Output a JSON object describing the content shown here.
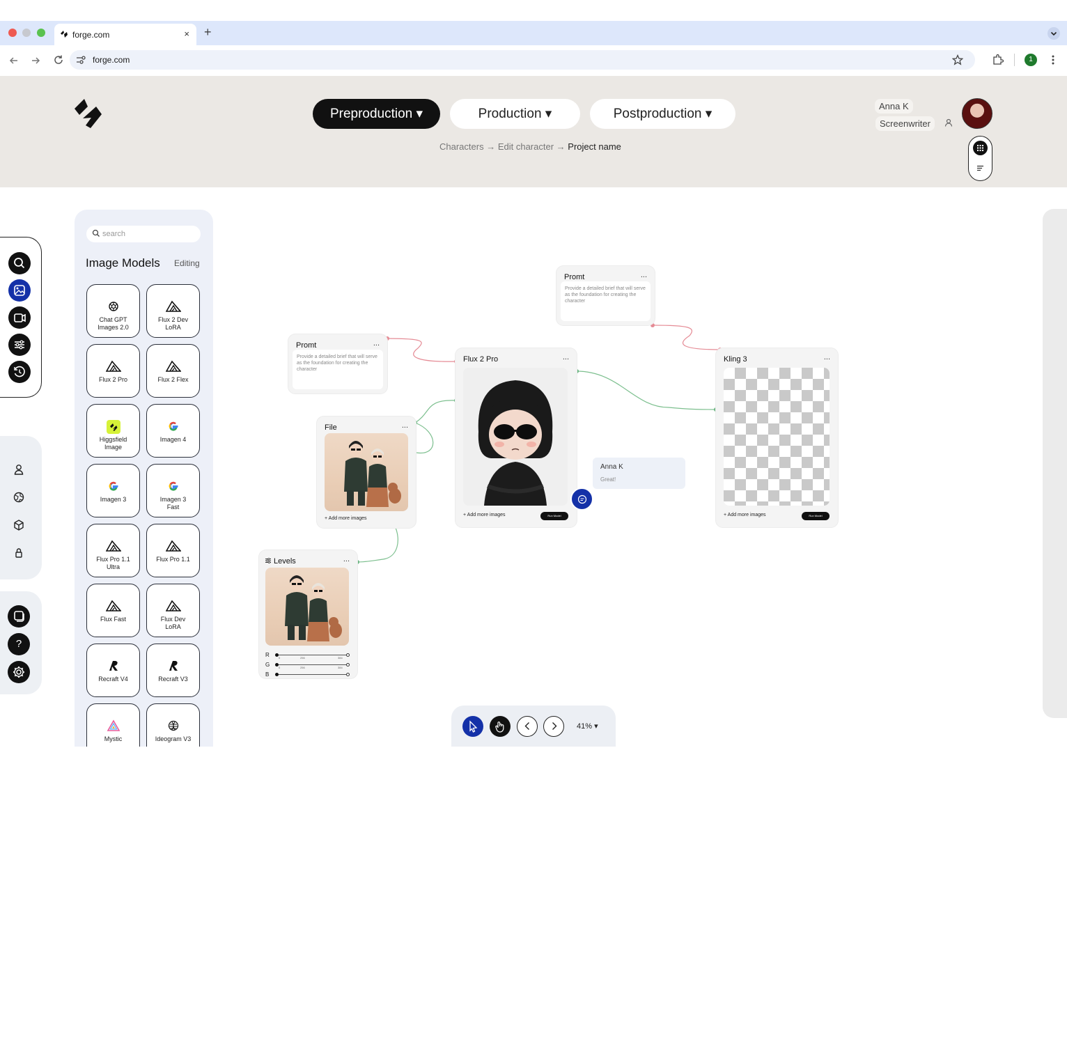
{
  "browser": {
    "tab_title": "forge.com",
    "tab_close": "×",
    "new_tab": "+",
    "url": "forge.com",
    "profile_badge": "1"
  },
  "header": {
    "phases": [
      "Preproduction ▾",
      "Production ▾",
      "Postproduction ▾"
    ],
    "breadcrumb": {
      "a": "Characters",
      "sep1": "→",
      "b": "Edit character",
      "sep2": "→",
      "c": "Project name"
    },
    "user_name": "Anna K",
    "user_role": "Screenwriter"
  },
  "panel": {
    "search_placeholder": "search",
    "title": "Image Models",
    "tab": "Editing",
    "models": [
      {
        "label": "Chat GPT\nImages 2.0",
        "icon": "openai-icon"
      },
      {
        "label": "Flux 2 Dev\nLoRA",
        "icon": "flux-icon"
      },
      {
        "label": "Flux 2 Pro",
        "icon": "flux-icon"
      },
      {
        "label": "Flux 2 Flex",
        "icon": "flux-icon"
      },
      {
        "label": "Higgsfield\nImage",
        "icon": "higgsfield-icon"
      },
      {
        "label": "Imagen 4",
        "icon": "google-icon"
      },
      {
        "label": "Imagen 3",
        "icon": "google-icon"
      },
      {
        "label": "Imagen 3\nFast",
        "icon": "google-icon"
      },
      {
        "label": "Flux Pro 1.1\nUltra",
        "icon": "flux-icon"
      },
      {
        "label": "Flux Pro 1.1",
        "icon": "flux-icon"
      },
      {
        "label": "Flux Fast",
        "icon": "flux-icon"
      },
      {
        "label": "Flux Dev\nLoRA",
        "icon": "flux-icon"
      },
      {
        "label": "Recraft V4",
        "icon": "recraft-icon"
      },
      {
        "label": "Recraft V3",
        "icon": "recraft-icon"
      },
      {
        "label": "Mystic",
        "icon": "mystic-icon"
      },
      {
        "label": "Ideogram V3",
        "icon": "ideogram-icon"
      }
    ]
  },
  "nodes": {
    "promt_top": {
      "title": "Promt",
      "text": "Provide a detailed brief that will serve as the foundation for creating the character"
    },
    "promt_left": {
      "title": "Promt",
      "text": "Provide a detailed brief that will serve as the foundation for creating the character"
    },
    "file": {
      "title": "File",
      "add": "+ Add more images"
    },
    "flux2pro": {
      "title": "Flux 2 Pro",
      "add": "+ Add more images",
      "run": "Run Model"
    },
    "kling3": {
      "title": "Kling 3",
      "add": "+ Add more images",
      "run": "Run Model"
    },
    "levels": {
      "title": "Levels",
      "channels": [
        "R",
        "G",
        "B"
      ],
      "r_ticks": [
        "0",
        "256",
        "384"
      ],
      "g_ticks": [
        "0",
        "256",
        "384"
      ]
    },
    "menu": "..."
  },
  "comment": {
    "author": "Anna K",
    "text": "Great!"
  },
  "toolbar": {
    "zoom": "41%",
    "zoom_caret": "▾"
  }
}
